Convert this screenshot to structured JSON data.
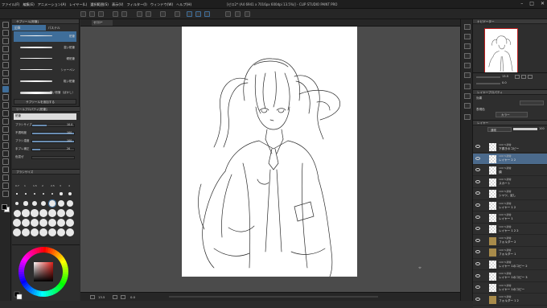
{
  "menubar": {
    "items": [
      "ファイル(F)",
      "編集(E)",
      "アニメーション(A)",
      "レイヤー(L)",
      "選択範囲(S)",
      "表示(V)",
      "フィルター(I)",
      "ウィンドウ(W)",
      "ヘルプ(H)"
    ],
    "window_title": "[ゼロ2* (A4 6941 x 7016px 600dpi 13.5%)] - CLIP STUDIO PAINT PRO"
  },
  "subtool": {
    "header": "サブツール[鉛筆]",
    "tabs": [
      "鉛筆",
      "パステル"
    ],
    "brushes": [
      {
        "label": "鉛筆",
        "selected": true
      },
      {
        "label": "濃い鉛筆",
        "selected": false
      },
      {
        "label": "硬鉛筆",
        "selected": false
      },
      {
        "label": "シャーペン",
        "selected": false
      },
      {
        "label": "粗い鉛筆",
        "selected": false
      },
      {
        "label": "濃い鉛筆（ぼかし）",
        "selected": false
      }
    ],
    "add_button": "サブツールを追加する"
  },
  "toolprop": {
    "header": "ツールプロパティ[鉛筆]",
    "brush_name": "鉛筆",
    "rows": [
      {
        "label": "ブラシサイズ",
        "value": "10.0",
        "level": 0.35
      },
      {
        "label": "不透明度",
        "value": "100",
        "level": 1.0
      },
      {
        "label": "ブラシ濃度",
        "value": "100",
        "level": 1.0
      },
      {
        "label": "手ブレ補正",
        "value": "20",
        "level": 0.2
      },
      {
        "label": "色混ぜ",
        "value": "",
        "level": 0.0
      }
    ]
  },
  "brushsize": {
    "header": "ブラシサイズ",
    "labels": [
      "0.7",
      "1",
      "1.5",
      "2",
      "2.5",
      "3",
      "4"
    ]
  },
  "canvas": {
    "tab_label": "ゼロ2*"
  },
  "statusbar": {
    "zoom": "13.5",
    "coords": "0.0"
  },
  "navigator": {
    "header": "ナビゲーター",
    "zoom_value": "13.5",
    "rotation_value": "0.0"
  },
  "layerprop": {
    "header": "レイヤープロパティ",
    "effect_label": "効果",
    "expression_color_label": "表現色",
    "expression_color_value": "カラー"
  },
  "layerpanel": {
    "header": "レイヤー",
    "blend_mode": "通常",
    "opacity": "100",
    "layers": [
      {
        "mode": "100 %通常",
        "name": "下書きのコピー",
        "folder": false,
        "selected": false
      },
      {
        "mode": "100 %通常",
        "name": "レイヤー 2 2",
        "folder": false,
        "selected": true
      },
      {
        "mode": "100 %通常",
        "name": "顔",
        "folder": false,
        "selected": false
      },
      {
        "mode": "100 %通常",
        "name": "スカート",
        "folder": false,
        "selected": false
      },
      {
        "mode": "100 %通常",
        "name": "シャツ、足し",
        "folder": false,
        "selected": false
      },
      {
        "mode": "100 %通常",
        "name": "レイヤー 1 2",
        "folder": false,
        "selected": false
      },
      {
        "mode": "100 %通常",
        "name": "レイヤー 1",
        "folder": false,
        "selected": false
      },
      {
        "mode": "100 %通常",
        "name": "レイヤー 1 2 2",
        "folder": false,
        "selected": false
      },
      {
        "mode": "100 %通常",
        "name": "フォルダー 2",
        "folder": true,
        "selected": false
      },
      {
        "mode": "100 %通常",
        "name": "フォルダー 1",
        "folder": true,
        "selected": false
      },
      {
        "mode": "100 %通常",
        "name": "レイヤー 1のコピー 2",
        "folder": false,
        "selected": false
      },
      {
        "mode": "100 %通常",
        "name": "レイヤー 1のコピー 3",
        "folder": false,
        "selected": false
      },
      {
        "mode": "100 %通常",
        "name": "レイヤー 1のコピー",
        "folder": false,
        "selected": false
      },
      {
        "mode": "100 %通常",
        "name": "フォルダー 1 2",
        "folder": true,
        "selected": false
      }
    ]
  },
  "colors": {
    "accent": "#3f6e9a",
    "main_color": "#000000",
    "sub_color": "#ffffff"
  }
}
